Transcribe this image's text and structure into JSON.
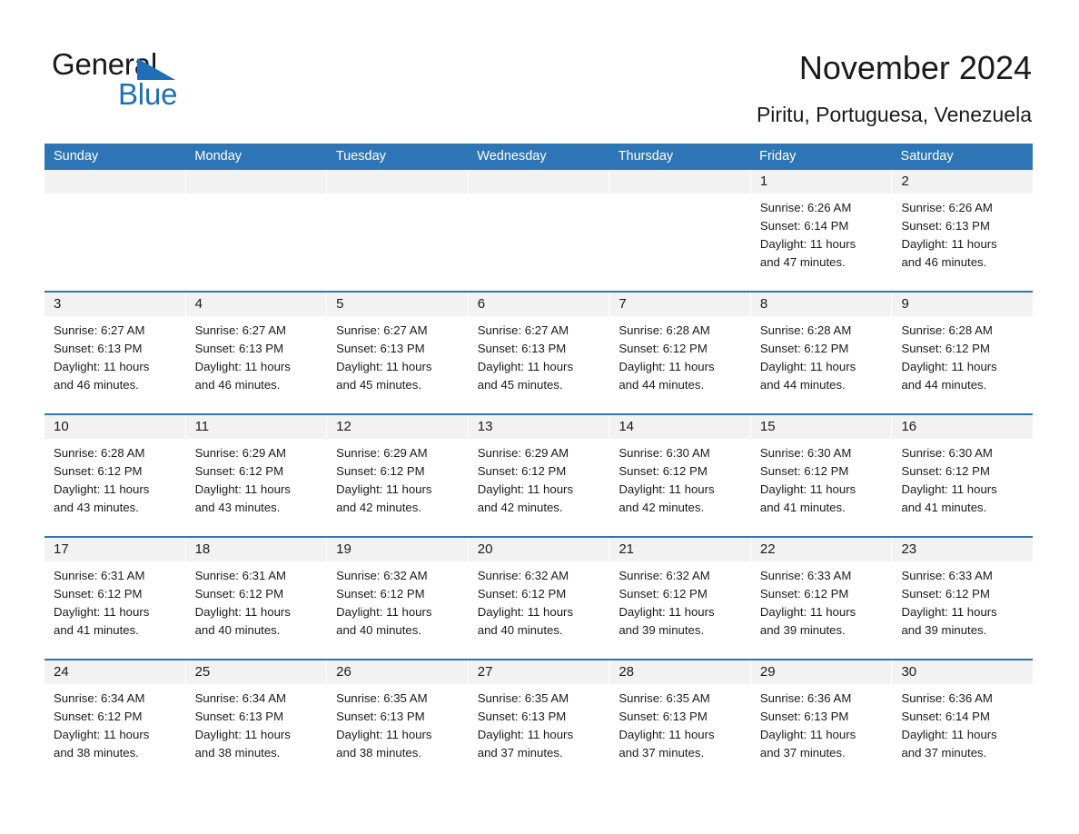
{
  "brand": {
    "name_top": "General",
    "name_bottom": "Blue",
    "accent_color": "#1E6FB8"
  },
  "header": {
    "title": "November 2024",
    "subtitle": "Piritu, Portuguesa, Venezuela",
    "header_bar_color": "#2E75B6",
    "daynum_band_color": "#F2F2F2"
  },
  "calendar": {
    "weekday_headers": [
      "Sunday",
      "Monday",
      "Tuesday",
      "Wednesday",
      "Thursday",
      "Friday",
      "Saturday"
    ],
    "weeks": [
      [
        {
          "day": "",
          "sunrise": "",
          "sunset": "",
          "daylight": "",
          "daylight2": ""
        },
        {
          "day": "",
          "sunrise": "",
          "sunset": "",
          "daylight": "",
          "daylight2": ""
        },
        {
          "day": "",
          "sunrise": "",
          "sunset": "",
          "daylight": "",
          "daylight2": ""
        },
        {
          "day": "",
          "sunrise": "",
          "sunset": "",
          "daylight": "",
          "daylight2": ""
        },
        {
          "day": "",
          "sunrise": "",
          "sunset": "",
          "daylight": "",
          "daylight2": ""
        },
        {
          "day": "1",
          "sunrise": "Sunrise: 6:26 AM",
          "sunset": "Sunset: 6:14 PM",
          "daylight": "Daylight: 11 hours",
          "daylight2": "and 47 minutes."
        },
        {
          "day": "2",
          "sunrise": "Sunrise: 6:26 AM",
          "sunset": "Sunset: 6:13 PM",
          "daylight": "Daylight: 11 hours",
          "daylight2": "and 46 minutes."
        }
      ],
      [
        {
          "day": "3",
          "sunrise": "Sunrise: 6:27 AM",
          "sunset": "Sunset: 6:13 PM",
          "daylight": "Daylight: 11 hours",
          "daylight2": "and 46 minutes."
        },
        {
          "day": "4",
          "sunrise": "Sunrise: 6:27 AM",
          "sunset": "Sunset: 6:13 PM",
          "daylight": "Daylight: 11 hours",
          "daylight2": "and 46 minutes."
        },
        {
          "day": "5",
          "sunrise": "Sunrise: 6:27 AM",
          "sunset": "Sunset: 6:13 PM",
          "daylight": "Daylight: 11 hours",
          "daylight2": "and 45 minutes."
        },
        {
          "day": "6",
          "sunrise": "Sunrise: 6:27 AM",
          "sunset": "Sunset: 6:13 PM",
          "daylight": "Daylight: 11 hours",
          "daylight2": "and 45 minutes."
        },
        {
          "day": "7",
          "sunrise": "Sunrise: 6:28 AM",
          "sunset": "Sunset: 6:12 PM",
          "daylight": "Daylight: 11 hours",
          "daylight2": "and 44 minutes."
        },
        {
          "day": "8",
          "sunrise": "Sunrise: 6:28 AM",
          "sunset": "Sunset: 6:12 PM",
          "daylight": "Daylight: 11 hours",
          "daylight2": "and 44 minutes."
        },
        {
          "day": "9",
          "sunrise": "Sunrise: 6:28 AM",
          "sunset": "Sunset: 6:12 PM",
          "daylight": "Daylight: 11 hours",
          "daylight2": "and 44 minutes."
        }
      ],
      [
        {
          "day": "10",
          "sunrise": "Sunrise: 6:28 AM",
          "sunset": "Sunset: 6:12 PM",
          "daylight": "Daylight: 11 hours",
          "daylight2": "and 43 minutes."
        },
        {
          "day": "11",
          "sunrise": "Sunrise: 6:29 AM",
          "sunset": "Sunset: 6:12 PM",
          "daylight": "Daylight: 11 hours",
          "daylight2": "and 43 minutes."
        },
        {
          "day": "12",
          "sunrise": "Sunrise: 6:29 AM",
          "sunset": "Sunset: 6:12 PM",
          "daylight": "Daylight: 11 hours",
          "daylight2": "and 42 minutes."
        },
        {
          "day": "13",
          "sunrise": "Sunrise: 6:29 AM",
          "sunset": "Sunset: 6:12 PM",
          "daylight": "Daylight: 11 hours",
          "daylight2": "and 42 minutes."
        },
        {
          "day": "14",
          "sunrise": "Sunrise: 6:30 AM",
          "sunset": "Sunset: 6:12 PM",
          "daylight": "Daylight: 11 hours",
          "daylight2": "and 42 minutes."
        },
        {
          "day": "15",
          "sunrise": "Sunrise: 6:30 AM",
          "sunset": "Sunset: 6:12 PM",
          "daylight": "Daylight: 11 hours",
          "daylight2": "and 41 minutes."
        },
        {
          "day": "16",
          "sunrise": "Sunrise: 6:30 AM",
          "sunset": "Sunset: 6:12 PM",
          "daylight": "Daylight: 11 hours",
          "daylight2": "and 41 minutes."
        }
      ],
      [
        {
          "day": "17",
          "sunrise": "Sunrise: 6:31 AM",
          "sunset": "Sunset: 6:12 PM",
          "daylight": "Daylight: 11 hours",
          "daylight2": "and 41 minutes."
        },
        {
          "day": "18",
          "sunrise": "Sunrise: 6:31 AM",
          "sunset": "Sunset: 6:12 PM",
          "daylight": "Daylight: 11 hours",
          "daylight2": "and 40 minutes."
        },
        {
          "day": "19",
          "sunrise": "Sunrise: 6:32 AM",
          "sunset": "Sunset: 6:12 PM",
          "daylight": "Daylight: 11 hours",
          "daylight2": "and 40 minutes."
        },
        {
          "day": "20",
          "sunrise": "Sunrise: 6:32 AM",
          "sunset": "Sunset: 6:12 PM",
          "daylight": "Daylight: 11 hours",
          "daylight2": "and 40 minutes."
        },
        {
          "day": "21",
          "sunrise": "Sunrise: 6:32 AM",
          "sunset": "Sunset: 6:12 PM",
          "daylight": "Daylight: 11 hours",
          "daylight2": "and 39 minutes."
        },
        {
          "day": "22",
          "sunrise": "Sunrise: 6:33 AM",
          "sunset": "Sunset: 6:12 PM",
          "daylight": "Daylight: 11 hours",
          "daylight2": "and 39 minutes."
        },
        {
          "day": "23",
          "sunrise": "Sunrise: 6:33 AM",
          "sunset": "Sunset: 6:12 PM",
          "daylight": "Daylight: 11 hours",
          "daylight2": "and 39 minutes."
        }
      ],
      [
        {
          "day": "24",
          "sunrise": "Sunrise: 6:34 AM",
          "sunset": "Sunset: 6:12 PM",
          "daylight": "Daylight: 11 hours",
          "daylight2": "and 38 minutes."
        },
        {
          "day": "25",
          "sunrise": "Sunrise: 6:34 AM",
          "sunset": "Sunset: 6:13 PM",
          "daylight": "Daylight: 11 hours",
          "daylight2": "and 38 minutes."
        },
        {
          "day": "26",
          "sunrise": "Sunrise: 6:35 AM",
          "sunset": "Sunset: 6:13 PM",
          "daylight": "Daylight: 11 hours",
          "daylight2": "and 38 minutes."
        },
        {
          "day": "27",
          "sunrise": "Sunrise: 6:35 AM",
          "sunset": "Sunset: 6:13 PM",
          "daylight": "Daylight: 11 hours",
          "daylight2": "and 37 minutes."
        },
        {
          "day": "28",
          "sunrise": "Sunrise: 6:35 AM",
          "sunset": "Sunset: 6:13 PM",
          "daylight": "Daylight: 11 hours",
          "daylight2": "and 37 minutes."
        },
        {
          "day": "29",
          "sunrise": "Sunrise: 6:36 AM",
          "sunset": "Sunset: 6:13 PM",
          "daylight": "Daylight: 11 hours",
          "daylight2": "and 37 minutes."
        },
        {
          "day": "30",
          "sunrise": "Sunrise: 6:36 AM",
          "sunset": "Sunset: 6:14 PM",
          "daylight": "Daylight: 11 hours",
          "daylight2": "and 37 minutes."
        }
      ]
    ]
  }
}
